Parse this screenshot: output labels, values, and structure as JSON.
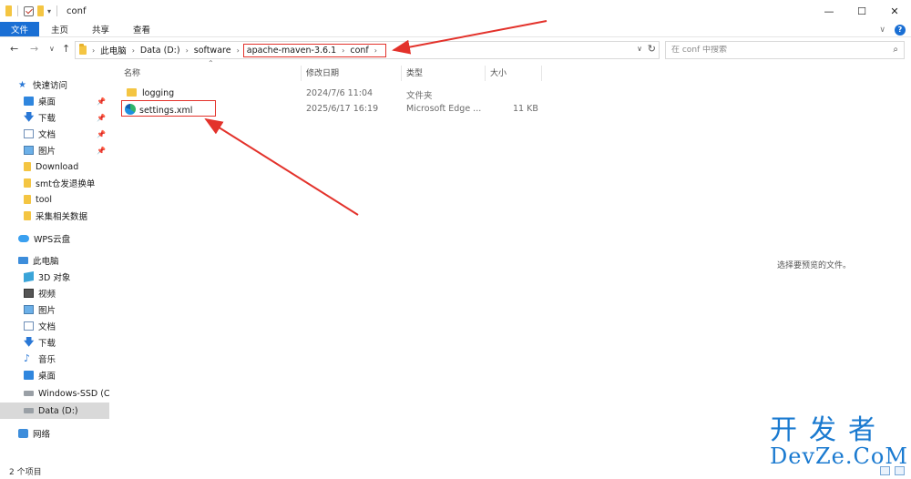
{
  "window": {
    "title": "conf",
    "minimize": "—",
    "maximize": "☐",
    "close": "✕"
  },
  "ribbon": {
    "tabs": [
      "文件",
      "主页",
      "共享",
      "查看"
    ],
    "expand": "∨",
    "help": "?"
  },
  "nav": {
    "back": "←",
    "forward": "→",
    "recent": "∨",
    "up": "↑",
    "breadcrumb": [
      "此电脑",
      "Data (D:)",
      "software",
      "apache-maven-3.6.1",
      "conf"
    ],
    "search_placeholder": "在 conf 中搜索"
  },
  "sidebar": {
    "items": [
      {
        "label": "快速访问",
        "icon": "star-icon"
      },
      {
        "label": "桌面",
        "icon": "desktop-icon",
        "pinned": true
      },
      {
        "label": "下载",
        "icon": "download-icon",
        "pinned": true
      },
      {
        "label": "文档",
        "icon": "document-icon",
        "pinned": true
      },
      {
        "label": "图片",
        "icon": "pictures-icon",
        "pinned": true
      },
      {
        "label": "Download",
        "icon": "folder-icon"
      },
      {
        "label": "smt仓发退换单",
        "icon": "folder-icon"
      },
      {
        "label": "tool",
        "icon": "folder-icon"
      },
      {
        "label": "采集相关数据",
        "icon": "folder-icon"
      },
      {
        "label": "WPS云盘",
        "icon": "cloud-icon"
      },
      {
        "label": "此电脑",
        "icon": "computer-icon"
      },
      {
        "label": "3D 对象",
        "icon": "3d-objects-icon"
      },
      {
        "label": "视频",
        "icon": "video-icon"
      },
      {
        "label": "图片",
        "icon": "pictures-icon"
      },
      {
        "label": "文档",
        "icon": "document-icon"
      },
      {
        "label": "下载",
        "icon": "download-icon"
      },
      {
        "label": "音乐",
        "icon": "music-icon"
      },
      {
        "label": "桌面",
        "icon": "desktop-icon"
      },
      {
        "label": "Windows-SSD (C:)",
        "icon": "drive-icon"
      },
      {
        "label": "Data (D:)",
        "icon": "drive-icon",
        "selected": true
      },
      {
        "label": "网络",
        "icon": "network-icon"
      }
    ]
  },
  "columns": [
    "名称",
    "修改日期",
    "类型",
    "大小"
  ],
  "files": [
    {
      "name": "logging",
      "date": "2024/7/6 11:04",
      "type": "文件夹",
      "size": "",
      "icon": "folder-icon"
    },
    {
      "name": "settings.xml",
      "date": "2025/6/17 16:19",
      "type": "Microsoft Edge ...",
      "size": "11 KB",
      "icon": "edge-icon"
    }
  ],
  "preview_text": "选择要预览的文件。",
  "status": {
    "count": "2 个项目"
  },
  "watermark": {
    "line1": "开发者",
    "line2": "DevZe.CoM"
  },
  "colors": {
    "accent": "#1a6fd4",
    "highlight": "#e3322b"
  }
}
